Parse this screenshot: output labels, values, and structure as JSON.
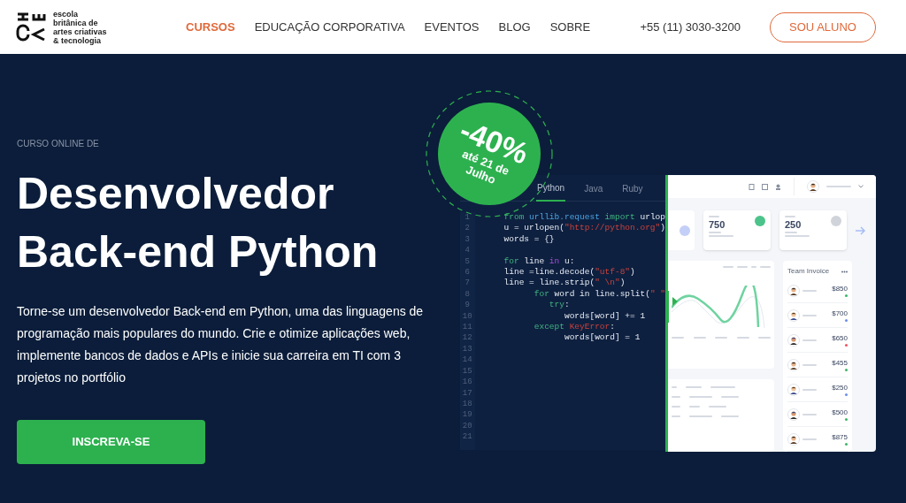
{
  "header": {
    "logo_text": [
      "escola",
      "britânica de",
      "artes criativas",
      "& tecnologia"
    ],
    "nav": [
      {
        "label": "CURSOS",
        "selected": true
      },
      {
        "label": "EDUCAÇÃO CORPORATIVA",
        "selected": false
      },
      {
        "label": "EVENTOS",
        "selected": false
      },
      {
        "label": "BLOG",
        "selected": false
      },
      {
        "label": "SOBRE",
        "selected": false
      }
    ],
    "phone": "+55 (11) 3030-3200",
    "cta": "SOU ALUNO"
  },
  "hero": {
    "eyebrow": "CURSO ONLINE DE",
    "title": [
      "Desenvolvedor",
      "Back-end Python"
    ],
    "description": "Torne-se um desenvolvedor Back-end em Python, uma das linguagens de programação mais populares do mundo. Crie e otimize aplicações web, implemente bancos de dados e APIs e inicie sua carreira em TI com 3 projetos no portfólio",
    "button": "INSCREVA-SE"
  },
  "badge": {
    "discount": "-40%",
    "until": [
      "até 21 de",
      "Julho"
    ]
  },
  "editor": {
    "tabs": [
      {
        "label": "Python",
        "selected": true
      },
      {
        "label": "Java",
        "selected": false
      },
      {
        "label": "Ruby",
        "selected": false
      }
    ],
    "line_numbers": [
      "1",
      "2",
      "3",
      "4",
      "5",
      "6",
      "7",
      "8",
      "9",
      "10",
      "11",
      "12",
      "13",
      "14",
      "15",
      "16",
      "17",
      "18",
      "19",
      "20",
      "21"
    ],
    "lines": [
      [
        {
          "text": "from",
          "kind": "keyword"
        },
        {
          "text": " urllib.request",
          "kind": "module"
        },
        {
          "text": " import",
          "kind": "keyword"
        },
        {
          "text": " urlop",
          "kind": "plain"
        }
      ],
      [
        {
          "text": "u = urlopen(",
          "kind": "plain"
        },
        {
          "text": "\"http://python.org\"",
          "kind": "string"
        },
        {
          "text": ")",
          "kind": "plain"
        }
      ],
      [
        {
          "text": "words = {}",
          "kind": "plain"
        }
      ],
      {
        "kind": "blank"
      },
      [
        {
          "text": "for",
          "kind": "keyword"
        },
        {
          "text": " line ",
          "kind": "plain"
        },
        {
          "text": "in",
          "kind": "operator"
        },
        {
          "text": " u:",
          "kind": "plain"
        }
      ],
      [
        {
          "text": "line =line.decode(",
          "kind": "plain"
        },
        {
          "text": "\"utf-8\"",
          "kind": "string"
        },
        {
          "text": ")",
          "kind": "plain"
        }
      ],
      [
        {
          "text": "line = line.strip(",
          "kind": "plain"
        },
        {
          "text": "\" \\n\"",
          "kind": "string"
        },
        {
          "text": ")",
          "kind": "plain"
        }
      ],
      [
        {
          "text": "      for",
          "kind": "keyword"
        },
        {
          "text": " word in line.split(",
          "kind": "plain"
        },
        {
          "text": "\" \"",
          "kind": "string"
        }
      ],
      [
        {
          "text": "         try",
          "kind": "keyword"
        },
        {
          "text": ":",
          "kind": "plain"
        }
      ],
      [
        {
          "text": "            words[word] += 1",
          "kind": "plain"
        }
      ],
      [
        {
          "text": "      except",
          "kind": "keyword"
        },
        {
          "text": " KeyError",
          "kind": "string"
        },
        {
          "text": ":",
          "kind": "plain"
        }
      ],
      [
        {
          "text": "            words[word] = 1",
          "kind": "plain"
        }
      ]
    ]
  },
  "dashboard": {
    "stats": [
      {
        "value": "750",
        "color": "#4cc38a"
      },
      {
        "value": "250",
        "color": "#d0d4da"
      }
    ],
    "invoice": {
      "title": "Team Invoice",
      "items": [
        {
          "amount": "$850",
          "color": "#3cb56a"
        },
        {
          "amount": "$700",
          "color": "#6c8ef0"
        },
        {
          "amount": "$650",
          "color": "#ef5461"
        },
        {
          "amount": "$455",
          "color": "#3cb56a"
        },
        {
          "amount": "$250",
          "color": "#6c8ef0"
        },
        {
          "amount": "$500",
          "color": "#3cb56a"
        },
        {
          "amount": "$875",
          "color": "#3cb56a"
        }
      ]
    }
  }
}
